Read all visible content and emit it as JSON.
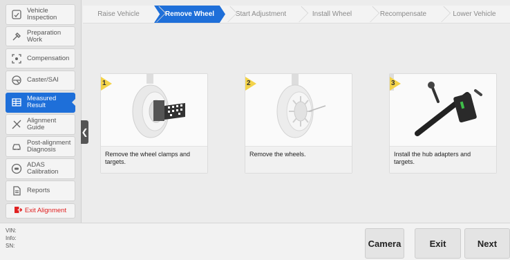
{
  "sidebar": {
    "items": [
      {
        "label": "Vehicle\nInspection",
        "icon": "vehicle-inspection-icon"
      },
      {
        "label": "Preparation\nWork",
        "icon": "tools-icon"
      },
      {
        "label": "Compensation",
        "icon": "compensation-icon"
      },
      {
        "label": "Caster/SAI",
        "icon": "caster-icon"
      },
      {
        "label": "Measured\nResult",
        "icon": "measured-result-icon"
      },
      {
        "label": "Alignment\nGuide",
        "icon": "alignment-guide-icon"
      },
      {
        "label": "Post-alignment\nDiagnosis",
        "icon": "car-icon"
      },
      {
        "label": "ADAS\nCalibration",
        "icon": "adas-icon"
      },
      {
        "label": "Reports",
        "icon": "report-icon"
      }
    ],
    "active_index": 4,
    "exit_label": "Exit Alignment",
    "exit_icon": "exit-icon"
  },
  "steps": [
    {
      "label": "Raise Vehicle"
    },
    {
      "label": "Remove Wheel"
    },
    {
      "label": "Start Adjustment"
    },
    {
      "label": "Install Wheel"
    },
    {
      "label": "Recompensate"
    },
    {
      "label": "Lower Vehicle"
    }
  ],
  "active_step": 1,
  "cards": [
    {
      "number": "1",
      "caption": "Remove the wheel clamps and targets."
    },
    {
      "number": "2",
      "caption": "Remove the wheels."
    },
    {
      "number": "3",
      "caption": "Install the hub adapters and targets."
    }
  ],
  "info": {
    "vin_label": "VIN:",
    "info_label": "Info:",
    "sn_label": "SN:"
  },
  "buttons": {
    "camera": "Camera",
    "exit": "Exit",
    "next": "Next"
  },
  "colors": {
    "accent": "#1e6fd9",
    "step_marker": "#f3d34a",
    "exit_text": "#e02020"
  }
}
